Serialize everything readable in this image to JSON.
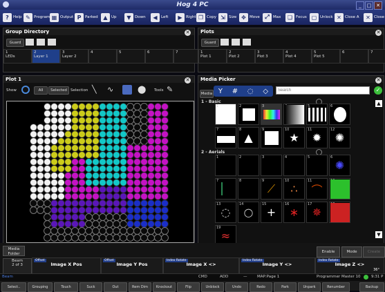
{
  "window": {
    "title": "Hog 4 PC"
  },
  "toolbar": [
    {
      "label": "Help",
      "icon": "help-icon",
      "glyph": "?"
    },
    {
      "label": "Program",
      "icon": "program-icon",
      "glyph": "✎"
    },
    {
      "label": "Output",
      "icon": "output-icon",
      "glyph": "▦"
    },
    {
      "label": "Parked",
      "icon": "parked-icon",
      "glyph": "P"
    },
    {
      "label": "Up",
      "icon": "arrow-up-icon",
      "glyph": "▲"
    },
    {
      "label": "Down",
      "icon": "arrow-down-icon",
      "glyph": "▼"
    },
    {
      "label": "Left",
      "icon": "arrow-left-icon",
      "glyph": "◀"
    },
    {
      "label": "Right",
      "icon": "arrow-right-icon",
      "glyph": "▶"
    },
    {
      "label": "Copy",
      "icon": "copy-icon",
      "glyph": "❐"
    },
    {
      "label": "Size",
      "icon": "size-icon",
      "glyph": "⇲"
    },
    {
      "label": "Move",
      "icon": "move-icon",
      "glyph": "✥"
    },
    {
      "label": "Max",
      "icon": "maximize-icon",
      "glyph": "⤢"
    },
    {
      "label": "Focus",
      "icon": "focus-icon",
      "glyph": "❏"
    },
    {
      "label": "Unlock",
      "icon": "unlock-icon",
      "glyph": "▢"
    },
    {
      "label": "Close A",
      "icon": "close-all-icon",
      "glyph": "✕"
    },
    {
      "label": "Close",
      "icon": "close-icon",
      "glyph": "✕"
    }
  ],
  "groupDirectory": {
    "title": "Group Directory",
    "guard": "Guard",
    "slots": [
      {
        "num": "1",
        "label": "LEDs"
      },
      {
        "num": "2",
        "label": "Layer 1"
      },
      {
        "num": "3",
        "label": "Layer 2"
      },
      {
        "num": "4",
        "label": ""
      },
      {
        "num": "5",
        "label": ""
      },
      {
        "num": "6",
        "label": ""
      },
      {
        "num": "7",
        "label": ""
      }
    ]
  },
  "plots": {
    "title": "Plots",
    "guard": "Guard",
    "slots": [
      {
        "num": "1",
        "label": "Plot 1"
      },
      {
        "num": "2",
        "label": "Plot 2"
      },
      {
        "num": "3",
        "label": "Plot 3"
      },
      {
        "num": "4",
        "label": "Plot 4"
      },
      {
        "num": "5",
        "label": "Plot 5"
      },
      {
        "num": "6",
        "label": ""
      },
      {
        "num": "7",
        "label": ""
      }
    ]
  },
  "plot1": {
    "title": "Plot 1",
    "show": "Show",
    "all": "All",
    "selected": "Selected",
    "selection": "Selection",
    "tools": "Tools",
    "colors": {
      "white": "#f2f2f2",
      "yellow": "#cccc1a",
      "cyan": "#12c8c8",
      "magenta": "#c412c4",
      "purple": "#5a16b8",
      "blue": "#1a2ec8",
      "empty": "#0a0a0a",
      "grey": "#8a8a8a"
    }
  },
  "mediaPicker": {
    "title": "Media Picker",
    "tab": "Media",
    "search_placeholder": "Search",
    "bank1": "1 - Basic",
    "bank2": "2 - Aerials",
    "cells1": [
      "1",
      "2",
      "3",
      "4",
      "5",
      "6",
      "7",
      "8",
      "9",
      "10",
      "11",
      "12"
    ],
    "cells2": [
      "1",
      "2",
      "3",
      "4",
      "5",
      "6",
      "7",
      "8",
      "9",
      "10",
      "11",
      "12",
      "13",
      "14",
      "15",
      "16",
      "17",
      "18",
      "19"
    ]
  },
  "bottom": {
    "mediaFolder": "Media\nFolder",
    "beam": "Beam",
    "beamPage": "2 of 3",
    "enable": "Enable",
    "mode": "Mode",
    "create": "Create",
    "encoders": [
      {
        "tag": "Offset",
        "label": "Image X Pos"
      },
      {
        "tag": "Offset",
        "label": "Image Y Pos"
      },
      {
        "tag": "Index Rotate",
        "label": "Image X <>"
      },
      {
        "tag": "Index Rotate",
        "label": "Image Y <>"
      },
      {
        "tag": "Index Rotate",
        "label": "Image Z <>",
        "value": "36°"
      }
    ]
  },
  "cmdline": {
    "left": "Beam",
    "cmd": "CMD",
    "add": "ADD",
    "dash": "—",
    "map": "MAP:Page 1",
    "programmer": "Programmer",
    "master": "Master 10",
    "time": "9:31 P"
  },
  "softkeys": [
    "Select..",
    "Grouping",
    "Touch",
    "Suck",
    "Out",
    "Rem Dim",
    "Knockout",
    "Flip",
    "Unblock",
    "Undo",
    "Redo",
    "Park",
    "Unpark",
    "Renumber",
    "Backup"
  ]
}
